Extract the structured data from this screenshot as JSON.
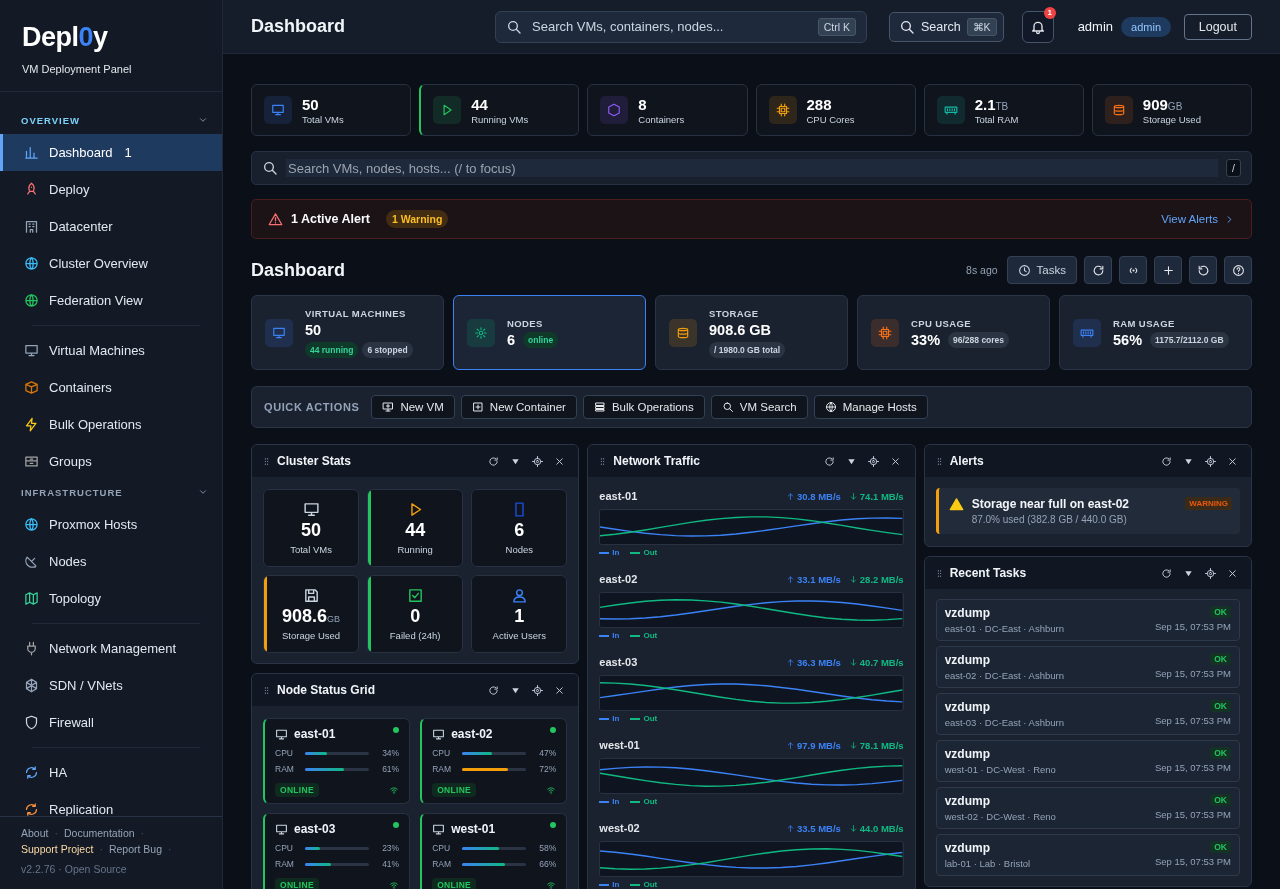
{
  "brand": {
    "prefix": "Depl",
    "accent": "0",
    "suffix": "y",
    "subtitle": "VM Deployment Panel"
  },
  "sidebar": {
    "sections": [
      {
        "title": "OVERVIEW",
        "expanded": true,
        "groups": [
          [
            {
              "label": "Dashboard",
              "selected": true,
              "badge": "1"
            },
            {
              "label": "Deploy",
              "selected": false
            },
            {
              "label": "Datacenter",
              "selected": false
            },
            {
              "label": "Cluster Overview",
              "selected": false
            },
            {
              "label": "Federation View",
              "selected": false
            }
          ],
          [
            {
              "label": "Virtual Machines",
              "selected": false
            },
            {
              "label": "Containers",
              "selected": false
            },
            {
              "label": "Bulk Operations",
              "selected": false
            },
            {
              "label": "Groups",
              "selected": false
            }
          ]
        ]
      },
      {
        "title": "INFRASTRUCTURE",
        "expanded": true,
        "groups": [
          [
            {
              "label": "Proxmox Hosts",
              "selected": false
            },
            {
              "label": "Nodes",
              "selected": false
            },
            {
              "label": "Topology",
              "selected": false
            }
          ],
          [
            {
              "label": "Network Management",
              "selected": false
            },
            {
              "label": "SDN / VNets",
              "selected": false
            },
            {
              "label": "Firewall",
              "selected": false
            }
          ],
          [
            {
              "label": "HA",
              "selected": false
            },
            {
              "label": "Replication",
              "selected": false
            }
          ]
        ]
      }
    ],
    "footer": {
      "separator": "·",
      "links": [
        {
          "label": "About",
          "highlighted": false
        },
        {
          "label": "Documentation",
          "highlighted": false
        },
        {
          "label": "Support Project",
          "highlighted": true
        },
        {
          "label": "Report Bug",
          "highlighted": false
        }
      ],
      "version": "v2.2.76 · Open Source"
    }
  },
  "header": {
    "title": "Dashboard",
    "search": {
      "placeholder": "Search VMs, containers, nodes...",
      "shortcut": "Ctrl K"
    },
    "search_button": {
      "label": "Search",
      "shortcut": "⌘K"
    },
    "notifications": {
      "count": "1"
    },
    "user": {
      "name": "admin",
      "role": "admin"
    },
    "logout": "Logout"
  },
  "stats": [
    {
      "value": "50",
      "label": "Total VMs",
      "highlighted": false
    },
    {
      "value": "44",
      "label": "Running VMs",
      "highlighted": true
    },
    {
      "value": "8",
      "label": "Containers",
      "highlighted": false
    },
    {
      "value": "288",
      "label": "CPU Cores",
      "highlighted": false
    },
    {
      "value": "2.1",
      "unit": "TB",
      "label": "Total RAM",
      "highlighted": false
    },
    {
      "value": "909",
      "unit": "GB",
      "label": "Storage Used",
      "highlighted": false
    }
  ],
  "search": {
    "placeholder": "Search VMs, nodes, hosts... (/ to focus)",
    "shortcut": "/"
  },
  "alert_banner": {
    "title": "1 Active Alert",
    "badge": "1 Warning",
    "link": "View Alerts"
  },
  "dashboard": {
    "title": "Dashboard",
    "updated": "8s ago",
    "tasks_button": "Tasks"
  },
  "summary": [
    {
      "title": "VIRTUAL MACHINES",
      "value": "50",
      "kind": "stacked",
      "selected": false,
      "badges": [
        {
          "text": "44 running",
          "kind": "success"
        },
        {
          "text": "6 stopped",
          "kind": "neutral"
        }
      ]
    },
    {
      "title": "NODES",
      "value": "6",
      "kind": "inline",
      "selected": true,
      "badges": [
        {
          "text": "online",
          "kind": "success"
        }
      ]
    },
    {
      "title": "STORAGE",
      "value": "908.6 GB",
      "kind": "stacked",
      "selected": false,
      "badges": [
        {
          "text": "/ 1980.0 GB total",
          "kind": "neutral"
        }
      ]
    },
    {
      "title": "CPU USAGE",
      "value": "33%",
      "kind": "inline",
      "selected": false,
      "badges": [
        {
          "text": "96/288 cores",
          "kind": "neutral"
        }
      ]
    },
    {
      "title": "RAM USAGE",
      "value": "56%",
      "kind": "inline",
      "selected": false,
      "badges": [
        {
          "text": "1175.7/2112.0 GB",
          "kind": "neutral"
        }
      ]
    }
  ],
  "quick_actions": {
    "title": "QUICK ACTIONS",
    "buttons": [
      "New VM",
      "New Container",
      "Bulk Operations",
      "VM Search",
      "Manage Hosts"
    ]
  },
  "cluster_stats": {
    "title": "Cluster Stats",
    "tiles": [
      {
        "value": "50",
        "label": "Total VMs"
      },
      {
        "value": "44",
        "label": "Running",
        "color": "#22c55e"
      },
      {
        "value": "6",
        "label": "Nodes"
      },
      {
        "value": "908.6",
        "unit": "GB",
        "label": "Storage Used",
        "color": "#f59e0b"
      },
      {
        "value": "0",
        "label": "Failed (24h)",
        "color": "#22c55e"
      },
      {
        "value": "1",
        "label": "Active Users"
      }
    ]
  },
  "node_grid": {
    "title": "Node Status Grid",
    "nodes": [
      {
        "name": "east-01",
        "online": true,
        "status": "ONLINE",
        "metrics": [
          {
            "label": "CPU",
            "level": 0.34,
            "reading": "34%"
          },
          {
            "label": "RAM",
            "level": 0.61,
            "reading": "61%"
          }
        ]
      },
      {
        "name": "east-02",
        "online": true,
        "status": "ONLINE",
        "metrics": [
          {
            "label": "CPU",
            "level": 0.47,
            "reading": "47%"
          },
          {
            "label": "RAM",
            "level": 0.72,
            "reading": "72%"
          }
        ]
      },
      {
        "name": "east-03",
        "online": true,
        "status": "ONLINE",
        "metrics": [
          {
            "label": "CPU",
            "level": 0.23,
            "reading": "23%"
          },
          {
            "label": "RAM",
            "level": 0.41,
            "reading": "41%"
          }
        ]
      },
      {
        "name": "west-01",
        "online": true,
        "status": "ONLINE",
        "metrics": [
          {
            "label": "CPU",
            "level": 0.58,
            "reading": "58%"
          },
          {
            "label": "RAM",
            "level": 0.66,
            "reading": "66%"
          }
        ]
      }
    ]
  },
  "network": {
    "title": "Network Traffic",
    "hosts": [
      {
        "name": "east-01",
        "in": "30.8 MB/s",
        "out": "74.1 MB/s",
        "legend_in": "In",
        "legend_out": "Out"
      },
      {
        "name": "east-02",
        "in": "33.1 MB/s",
        "out": "28.2 MB/s",
        "legend_in": "In",
        "legend_out": "Out"
      },
      {
        "name": "east-03",
        "in": "36.3 MB/s",
        "out": "40.7 MB/s",
        "legend_in": "In",
        "legend_out": "Out"
      },
      {
        "name": "west-01",
        "in": "97.9 MB/s",
        "out": "78.1 MB/s",
        "legend_in": "In",
        "legend_out": "Out"
      },
      {
        "name": "west-02",
        "in": "33.5 MB/s",
        "out": "44.0 MB/s",
        "legend_in": "In",
        "legend_out": "Out"
      }
    ]
  },
  "alerts": {
    "title": "Alerts",
    "items": [
      {
        "title": "Storage near full on east-02",
        "detail": "87.0% used (382.8 GB / 440.0 GB)",
        "kind": "warning",
        "label": "WARNING"
      }
    ]
  },
  "tasks": {
    "title": "Recent Tasks",
    "items": [
      {
        "name": "vzdump",
        "location": "east-01 · DC-East · Ashburn",
        "status": "OK",
        "kind": "success",
        "time": "Sep 15, 07:53 PM"
      },
      {
        "name": "vzdump",
        "location": "east-02 · DC-East · Ashburn",
        "status": "OK",
        "kind": "success",
        "time": "Sep 15, 07:53 PM"
      },
      {
        "name": "vzdump",
        "location": "east-03 · DC-East · Ashburn",
        "status": "OK",
        "kind": "success",
        "time": "Sep 15, 07:53 PM"
      },
      {
        "name": "vzdump",
        "location": "west-01 · DC-West · Reno",
        "status": "OK",
        "kind": "success",
        "time": "Sep 15, 07:53 PM"
      },
      {
        "name": "vzdump",
        "location": "west-02 · DC-West · Reno",
        "status": "OK",
        "kind": "success",
        "time": "Sep 15, 07:53 PM"
      },
      {
        "name": "vzdump",
        "location": "lab-01 · Lab · Bristol",
        "status": "OK",
        "kind": "success",
        "time": "Sep 15, 07:53 PM"
      }
    ]
  }
}
